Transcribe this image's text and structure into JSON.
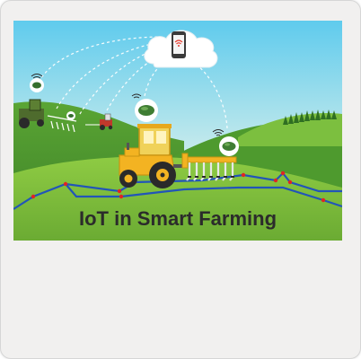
{
  "illustration": {
    "caption": "IoT in Smart Farming",
    "icons": {
      "cloud": "cloud-icon",
      "phone": "smartphone-icon",
      "wifi": "wifi-icon",
      "tractor": "tractor-icon",
      "sensor": "sensor-node-icon"
    },
    "colors": {
      "sky_top": "#6fd1ee",
      "sky_bottom": "#eaf7e3",
      "hill_dark": "#3f8b2a",
      "hill_light": "#8ac53d",
      "field": "#7bbb3b",
      "tractor_body": "#f3b322",
      "sensor_line": "#2255b8",
      "sensor_node": "#e02424"
    }
  }
}
